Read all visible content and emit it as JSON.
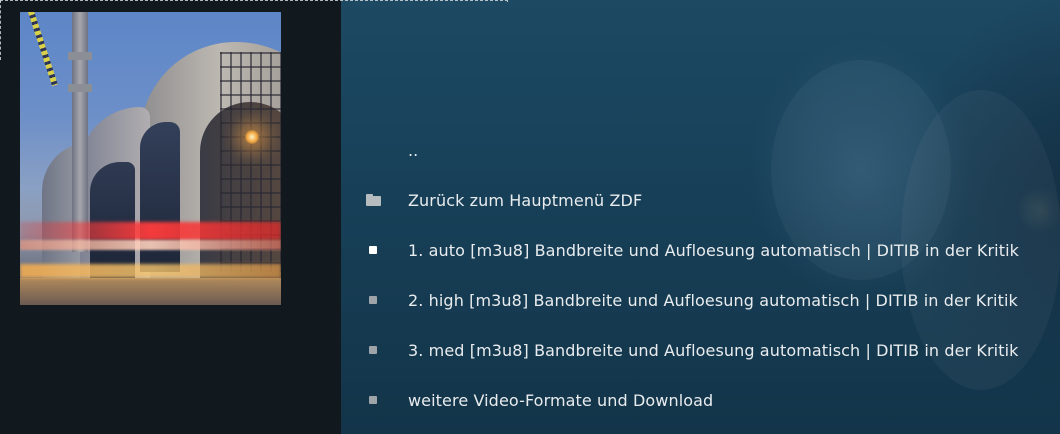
{
  "list": {
    "items": [
      {
        "label": "..",
        "icon": "none",
        "bullet_color": ""
      },
      {
        "label": "Zurück zum Hauptmenü ZDF",
        "icon": "folder-icon"
      },
      {
        "label": "1. auto [m3u8] Bandbreite und Aufloesung automatisch | DITIB in der Kritik",
        "icon": "bullet-icon",
        "bullet_color": "#ffffff"
      },
      {
        "label": "2. high [m3u8] Bandbreite und Aufloesung automatisch | DITIB in der Kritik",
        "icon": "bullet-icon",
        "bullet_color": "#9ea4a8"
      },
      {
        "label": "3. med [m3u8] Bandbreite und Aufloesung automatisch | DITIB in der Kritik",
        "icon": "bullet-icon",
        "bullet_color": "#9ea4a8"
      },
      {
        "label": "weitere Video-Formate und Download",
        "icon": "bullet-icon",
        "bullet_color": "#9ea4a8"
      }
    ]
  },
  "colors": {
    "left_panel": "#12191e",
    "fanart_base": "#174058",
    "text": "#e9ecee",
    "focus_outline": "#cfd6da"
  }
}
